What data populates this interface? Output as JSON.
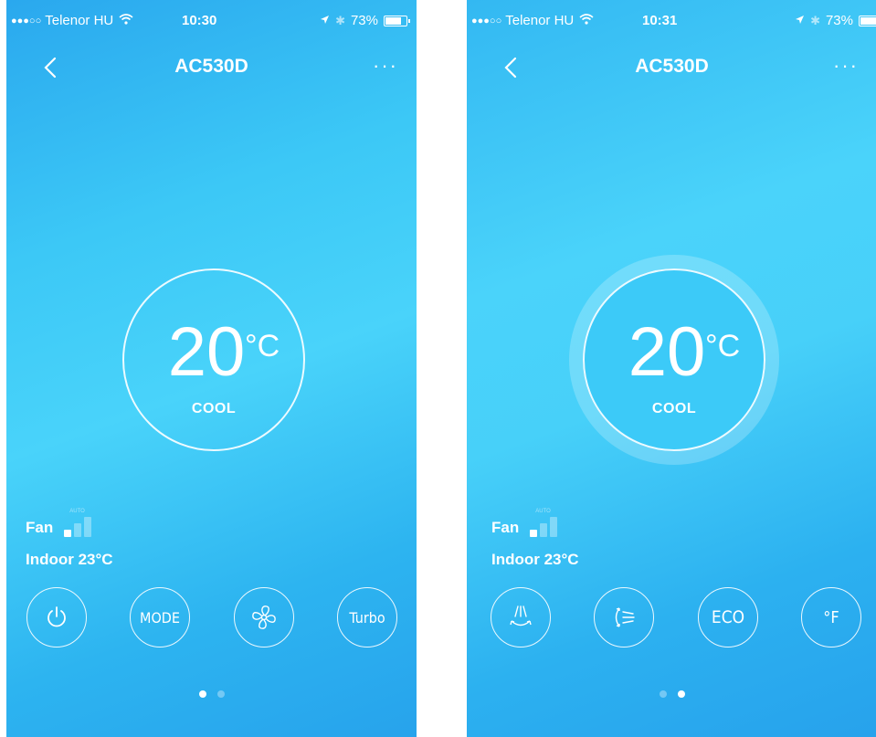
{
  "screens": [
    {
      "status": {
        "carrier": "Telenor HU",
        "time": "10:30",
        "battery": "73%"
      },
      "header": {
        "title": "AC530D"
      },
      "dial": {
        "temperature": "20",
        "unit": "°C",
        "mode": "COOL"
      },
      "fan": {
        "label": "Fan",
        "auto_tag": "AUTO",
        "level": 1,
        "levels": 3
      },
      "indoor": "Indoor 23°C",
      "controls": {
        "power": {
          "icon": "power-icon"
        },
        "mode": {
          "label": "MODE"
        },
        "fan": {
          "icon": "fan-icon"
        },
        "turbo": {
          "label": "Turbo"
        }
      },
      "page_index": 0
    },
    {
      "status": {
        "carrier": "Telenor HU",
        "time": "10:31",
        "battery": "73%"
      },
      "header": {
        "title": "AC530D"
      },
      "dial": {
        "temperature": "20",
        "unit": "°C",
        "mode": "COOL"
      },
      "fan": {
        "label": "Fan",
        "auto_tag": "AUTO",
        "level": 1,
        "levels": 3
      },
      "indoor": "Indoor 23°C",
      "controls": {
        "swing_vertical": {
          "icon": "vertical-swing-icon"
        },
        "swing_horizontal": {
          "icon": "horizontal-swing-icon"
        },
        "eco": {
          "label": "ECO"
        },
        "fahrenheit": {
          "label": "°F"
        }
      },
      "page_index": 1
    }
  ],
  "pager": {
    "pages": 2
  },
  "colors": {
    "background_top": "#2aa8ee",
    "background_mid": "#49d3fa",
    "foreground": "#ffffff"
  }
}
